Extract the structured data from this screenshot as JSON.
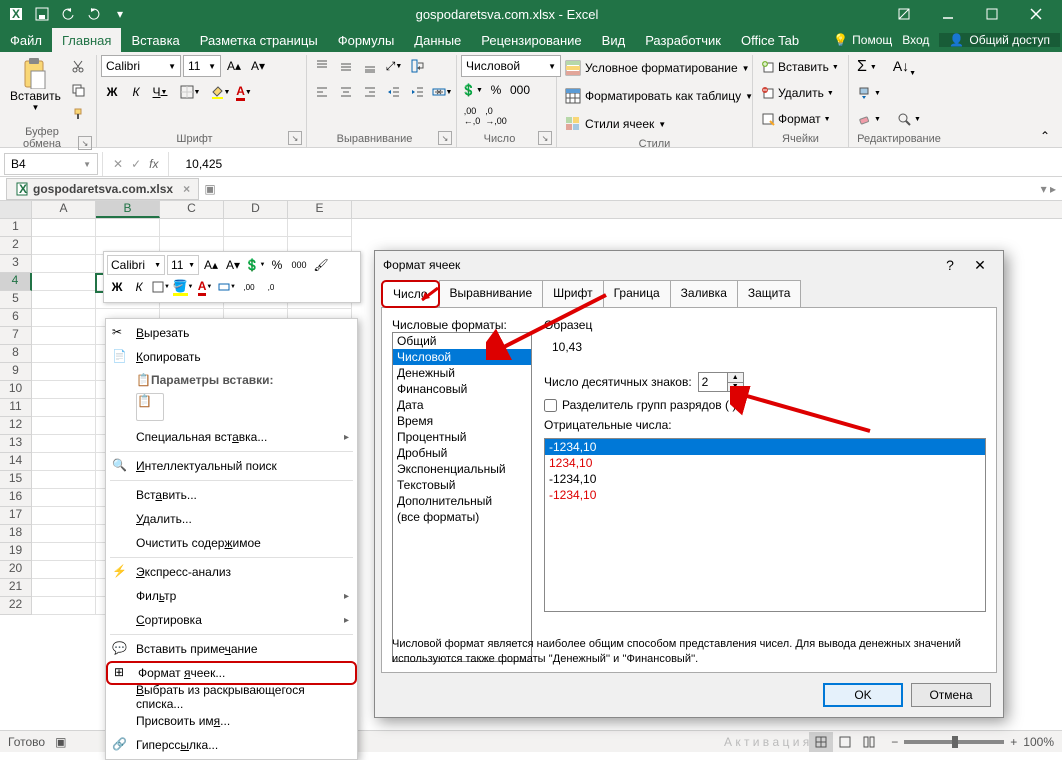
{
  "titlebar": {
    "title": "gospodaretsva.com.xlsx - Excel"
  },
  "menu": {
    "file": "Файл",
    "home": "Главная",
    "insert": "Вставка",
    "layout": "Разметка страницы",
    "formulas": "Формулы",
    "data": "Данные",
    "review": "Рецензирование",
    "view": "Вид",
    "developer": "Разработчик",
    "officetab": "Office Tab",
    "tell": "Помощ",
    "signin": "Вход",
    "share": "Общий доступ"
  },
  "ribbon": {
    "clipboard": {
      "label": "Буфер обмена",
      "paste": "Вставить"
    },
    "font": {
      "label": "Шрифт",
      "name": "Calibri",
      "size": "11"
    },
    "alignment": {
      "label": "Выравнивание"
    },
    "number": {
      "label": "Число",
      "format": "Числовой"
    },
    "styles": {
      "label": "Стили",
      "cond": "Условное форматирование",
      "table": "Форматировать как таблицу",
      "cellstyles": "Стили ячеек"
    },
    "cells": {
      "label": "Ячейки",
      "insert": "Вставить",
      "delete": "Удалить",
      "format": "Формат"
    },
    "editing": {
      "label": "Редактирование"
    }
  },
  "formulabar": {
    "name": "B4",
    "value": "10,425"
  },
  "filetab": {
    "name": "gospodaretsva.com.xlsx"
  },
  "columns": [
    "A",
    "B",
    "C",
    "D",
    "E"
  ],
  "mini": {
    "font": "Calibri",
    "size": "11"
  },
  "context": {
    "cut": "Вырезать",
    "copy": "Копировать",
    "pasteopts": "Параметры вставки:",
    "pastespecial": "Специальная вставка...",
    "smartlookup": "Интеллектуальный поиск",
    "insert": "Вставить...",
    "delete": "Удалить...",
    "clear": "Очистить содержимое",
    "quick": "Экспресс-анализ",
    "filter": "Фильтр",
    "sort": "Сортировка",
    "comment": "Вставить примечание",
    "formatcells": "Формат ячеек...",
    "picklist": "Выбрать из раскрывающегося списка...",
    "definename": "Присвоить имя...",
    "hyperlink": "Гиперссылка..."
  },
  "dialog": {
    "title": "Формат ячеек",
    "tabs": {
      "number": "Число",
      "alignment": "Выравнивание",
      "font": "Шрифт",
      "border": "Граница",
      "fill": "Заливка",
      "protection": "Защита"
    },
    "categories_label": "Числовые форматы:",
    "categories": [
      "Общий",
      "Числовой",
      "Денежный",
      "Финансовый",
      "Дата",
      "Время",
      "Процентный",
      "Дробный",
      "Экспоненциальный",
      "Текстовый",
      "Дополнительный",
      "(все форматы)"
    ],
    "sample_label": "Образец",
    "sample_value": "10,43",
    "decimals_label": "Число десятичных знаков:",
    "decimals_value": "2",
    "thousands_label": "Разделитель групп разрядов ( )",
    "neg_label": "Отрицательные числа:",
    "neg_options": [
      "-1234,10",
      "1234,10",
      "-1234,10",
      "-1234,10"
    ],
    "desc": "Числовой формат является наиболее общим способом представления чисел. Для вывода денежных значений используются также форматы ''Денежный'' и ''Финансовый''.",
    "ok": "OK",
    "cancel": "Отмена"
  },
  "status": {
    "ready": "Готово",
    "activation": "Активация",
    "zoom": "100%"
  }
}
